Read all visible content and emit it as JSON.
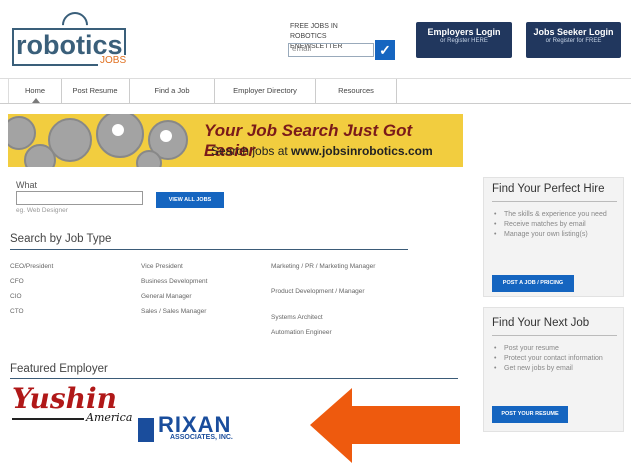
{
  "header": {
    "logo": {
      "word": "robotics",
      "sub": "JOBS"
    },
    "newsletter": {
      "line1": "FREE JOBS IN ROBOTICS",
      "line2": "ENEWSLETTER",
      "email_value": "email",
      "submit_icon": "✓"
    },
    "employers_login": {
      "label": "Employers Login",
      "sub": "or Register HERE"
    },
    "seeker_login": {
      "label": "Jobs Seeker Login",
      "sub": "or Register for FREE"
    }
  },
  "nav": {
    "items": [
      {
        "label": "Home"
      },
      {
        "label": "Post Resume"
      },
      {
        "label": "Find a Job"
      },
      {
        "label": "Employer Directory"
      },
      {
        "label": "Resources"
      }
    ]
  },
  "banner": {
    "headline": "Your Job Search Just Got Easier",
    "sub_prefix": "Search jobs at ",
    "sub_url": "www.jobsinrobotics.com"
  },
  "search": {
    "what_label": "What",
    "hint": "eg. Web Designer",
    "view_all_label": "VIEW ALL JOBS"
  },
  "job_types": {
    "title": "Search by Job Type",
    "col1": [
      "CEO/President",
      "CFO",
      "CIO",
      "CTO"
    ],
    "col2": [
      "Vice President",
      "Business Development",
      "General Manager",
      "Sales / Sales Manager"
    ],
    "col3": [
      "Marketing / PR / Marketing Manager",
      "Product Development / Manager",
      "Systems Architect",
      "Automation Engineer"
    ]
  },
  "featured": {
    "title": "Featured Employer",
    "yushin": {
      "name": "Yushin",
      "sub": "America"
    },
    "rixan": {
      "name": "RIXAN",
      "sub": "ASSOCIATES, INC."
    }
  },
  "hire_panel": {
    "title": "Find Your Perfect Hire",
    "bullets": [
      "The skills & experience you need",
      "Receive matches by email",
      "Manage your own listing(s)"
    ],
    "button": "POST A JOB / PRICING"
  },
  "job_panel": {
    "title": "Find Your Next Job",
    "bullets": [
      "Post your resume",
      "Protect your contact information",
      "Get new jobs by email"
    ],
    "button": "POST YOUR RESUME"
  },
  "colors": {
    "navy": "#21375e",
    "button_blue": "#1565c0",
    "banner_yellow": "#f2cd3f",
    "arrow_orange": "#ee5a0e"
  },
  "icons": [
    "checkmark-icon",
    "gear-icon",
    "person-icon",
    "arrow-left-icon",
    "nav-caret-icon"
  ]
}
